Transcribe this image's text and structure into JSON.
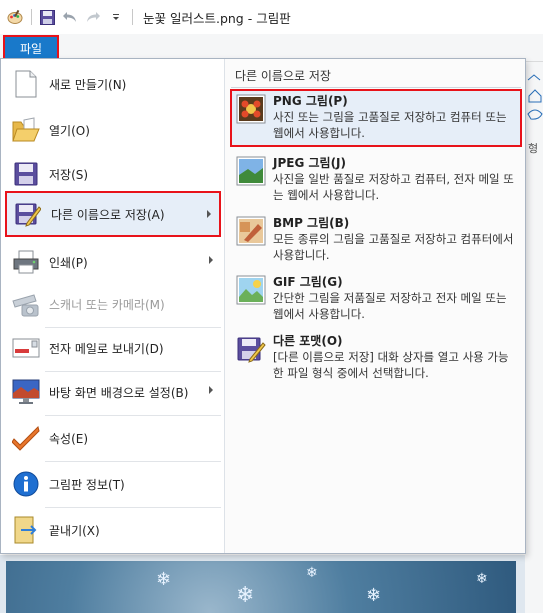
{
  "window": {
    "title": "눈꽃 일러스트.png - 그림판"
  },
  "ribbon": {
    "file_tab": "파일",
    "right_fragment": "형"
  },
  "menu": {
    "left_items": [
      {
        "label": "새로 만들기(N)",
        "icon": "new-document-icon"
      },
      {
        "label": "열기(O)",
        "icon": "open-folder-icon"
      },
      {
        "label": "저장(S)",
        "icon": "save-disk-icon"
      },
      {
        "label": "다른 이름으로 저장(A)",
        "icon": "save-as-icon",
        "submenu": true,
        "highlighted": true
      },
      {
        "label": "인쇄(P)",
        "icon": "printer-icon",
        "submenu": true
      },
      {
        "label": "스캐너 또는 카메라(M)",
        "icon": "scanner-camera-icon",
        "disabled": true
      },
      {
        "label": "전자 메일로 보내기(D)",
        "icon": "email-icon"
      },
      {
        "label": "바탕 화면 배경으로 설정(B)",
        "icon": "desktop-background-icon",
        "submenu": true
      },
      {
        "label": "속성(E)",
        "icon": "properties-check-icon"
      },
      {
        "label": "그림판 정보(T)",
        "icon": "info-icon"
      },
      {
        "label": "끝내기(X)",
        "icon": "exit-icon"
      }
    ],
    "submenu_title": "다른 이름으로 저장",
    "submenu_items": [
      {
        "title": "PNG 그림(P)",
        "desc": "사진 또는 그림을 고품질로 저장하고 컴퓨터 또는 웹에서 사용합니다.",
        "icon": "png-image-icon",
        "highlighted": true
      },
      {
        "title": "JPEG 그림(J)",
        "desc": "사진을 일반 품질로 저장하고 컴퓨터, 전자 메일 또는 웹에서 사용합니다.",
        "icon": "jpeg-image-icon"
      },
      {
        "title": "BMP 그림(B)",
        "desc": "모든 종류의 그림을 고품질로 저장하고 컴퓨터에서 사용합니다.",
        "icon": "bmp-image-icon"
      },
      {
        "title": "GIF 그림(G)",
        "desc": "간단한 그림을 저품질로 저장하고 전자 메일 또는 웹에서 사용합니다.",
        "icon": "gif-image-icon"
      },
      {
        "title": "다른 포맷(O)",
        "desc": "[다른 이름으로 저장] 대화 상자를 열고 사용 가능한 파일 형식 중에서 선택합니다.",
        "icon": "other-format-icon"
      }
    ]
  },
  "colors": {
    "accent": "#1979ca",
    "highlight_border": "#e8121a",
    "hover_bg": "#e6eef8"
  }
}
